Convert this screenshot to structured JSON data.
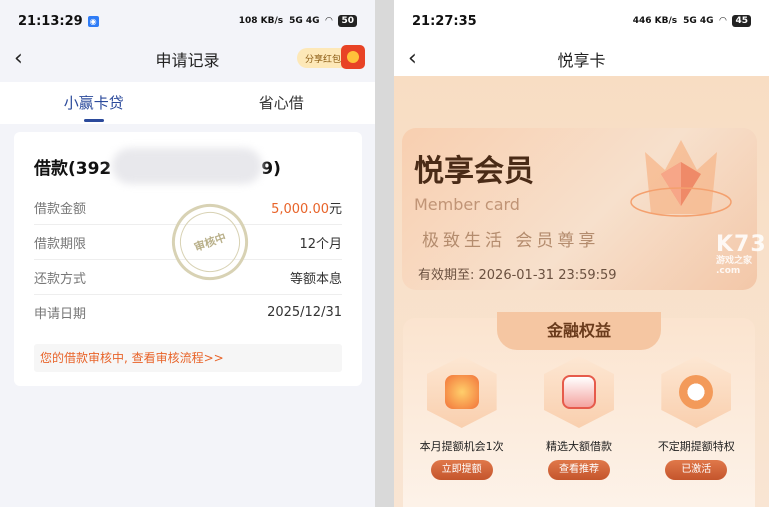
{
  "left": {
    "status": {
      "time": "21:13:29",
      "speed": "108 KB/s",
      "net": "5G 4G",
      "battery": "50"
    },
    "nav": {
      "title": "申请记录",
      "share_label": "分享红包"
    },
    "tabs": [
      {
        "label": "小赢卡贷",
        "active": true
      },
      {
        "label": "省心借",
        "active": false
      }
    ],
    "card": {
      "title_prefix": "借款(392",
      "title_suffix": "9)",
      "stamp": "审核中",
      "rows": [
        {
          "label": "借款金额",
          "value": "5,000.00",
          "unit": "元"
        },
        {
          "label": "借款期限",
          "value": "12个月"
        },
        {
          "label": "还款方式",
          "value": "等额本息"
        },
        {
          "label": "申请日期",
          "value": "2025/12/31"
        }
      ],
      "notice": "您的借款审核中, 查看审核流程>>"
    }
  },
  "right": {
    "status": {
      "time": "21:27:35",
      "speed": "446 KB/s",
      "net": "5G 4G",
      "battery": "45"
    },
    "nav": {
      "title": "悦享卡"
    },
    "member": {
      "title": "悦享会员",
      "subtitle": "Member card",
      "slogan": "极致生活 会员尊享",
      "validity": "有效期至: 2026-01-31 23:59:59"
    },
    "watermark": {
      "text": "K73",
      "sub": "游戏之家 .com"
    },
    "panel": {
      "title": "金融权益",
      "benefits": [
        {
          "label": "本月提额机会1次",
          "button": "立即提额",
          "icon": "coin-stack-icon"
        },
        {
          "label": "精选大额借款",
          "button": "查看推荐",
          "icon": "gift-box-icon"
        },
        {
          "label": "不定期提额特权",
          "button": "已激活",
          "icon": "alarm-clock-icon"
        }
      ]
    }
  }
}
